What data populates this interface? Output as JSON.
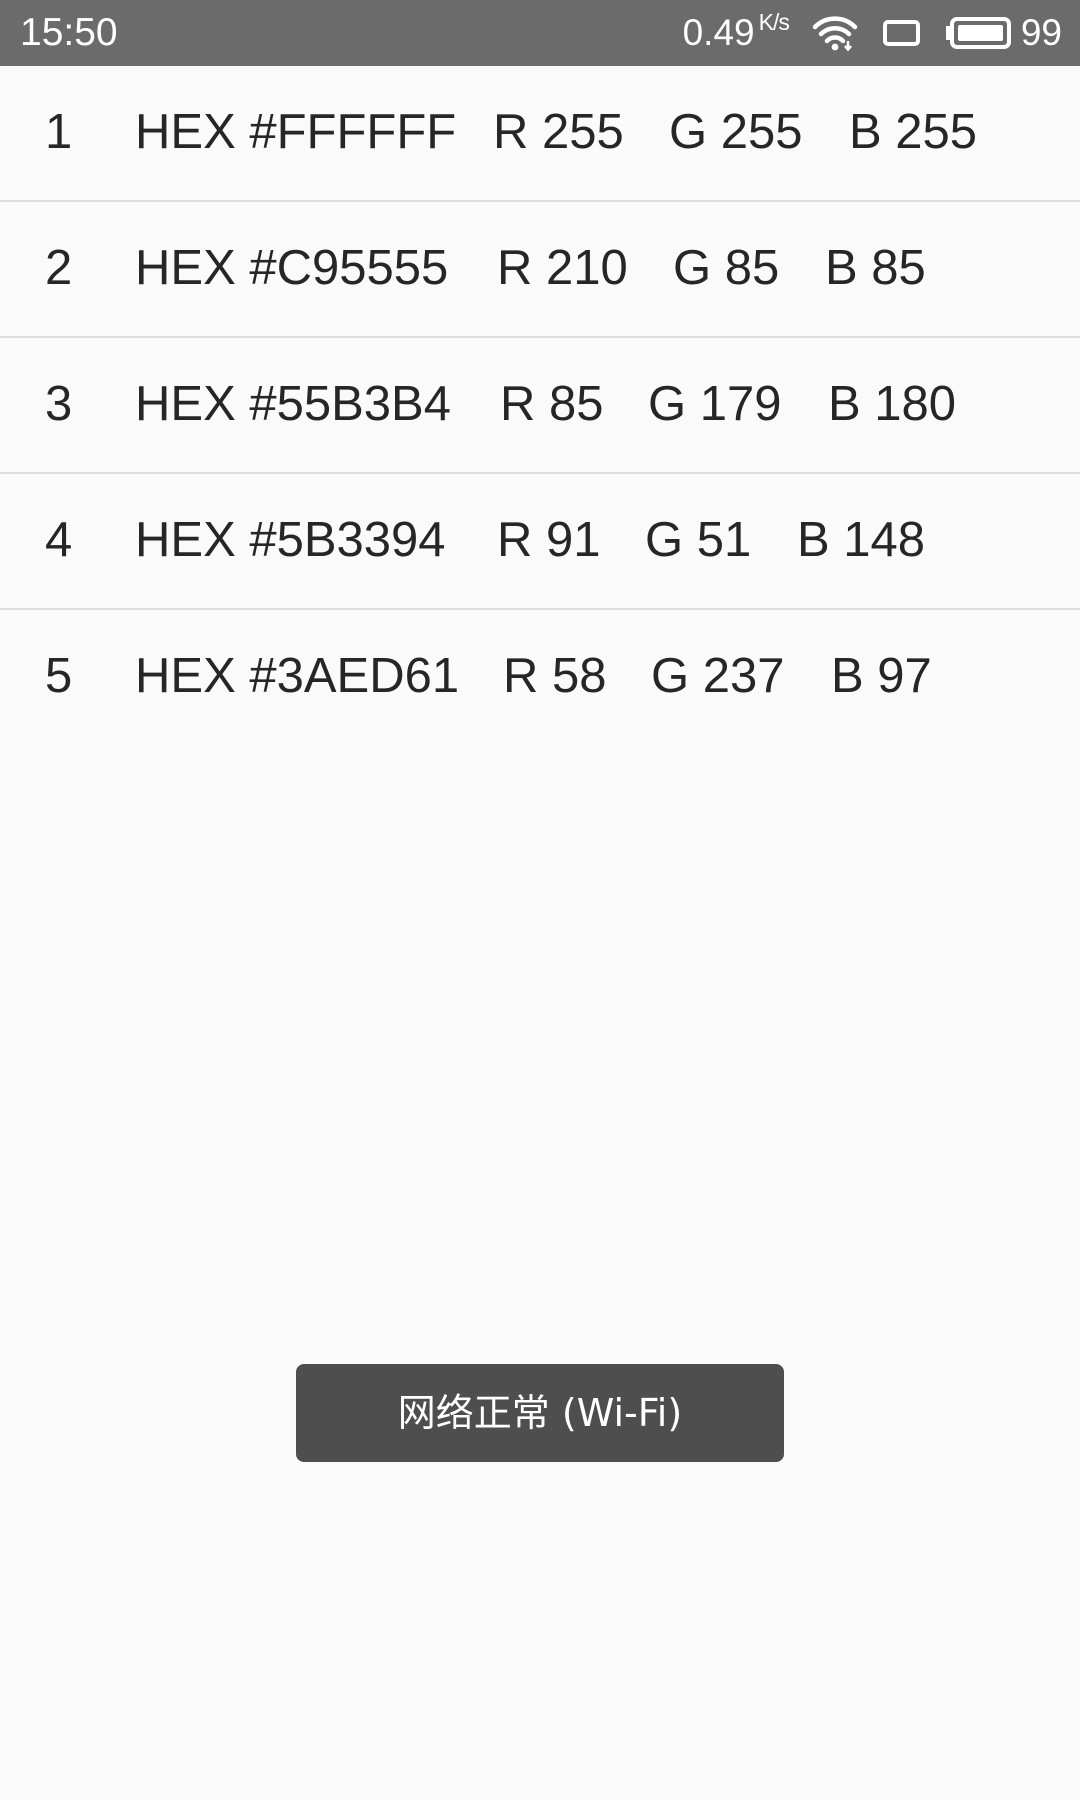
{
  "status_bar": {
    "time": "15:50",
    "net_speed": "0.49",
    "net_unit": "K/s",
    "battery": "99",
    "icons": [
      "wifi-icon",
      "screen-rotation-icon",
      "battery-icon"
    ]
  },
  "colors": [
    {
      "index": "1",
      "hex": "HEX #FFFFFF",
      "r": "R 255",
      "g": "G 255",
      "b": "B 255"
    },
    {
      "index": "2",
      "hex": "HEX #C95555",
      "r": "R 210",
      "g": "G 85",
      "b": "B 85"
    },
    {
      "index": "3",
      "hex": "HEX #55B3B4",
      "r": "R 85",
      "g": "G 179",
      "b": "B 180"
    },
    {
      "index": "4",
      "hex": "HEX #5B3394",
      "r": "R 91",
      "g": "G 51",
      "b": "B 148"
    },
    {
      "index": "5",
      "hex": "HEX #3AED61",
      "r": "R 58",
      "g": "G 237",
      "b": "B 97"
    }
  ],
  "toast": {
    "message": "网络正常 (Wi-Fi)"
  },
  "theme": {
    "status_bar_bg": "#6b6b6b",
    "page_bg": "#fafafa",
    "divider": "#dcdcdc",
    "toast_bg": "#4e4e4e"
  }
}
